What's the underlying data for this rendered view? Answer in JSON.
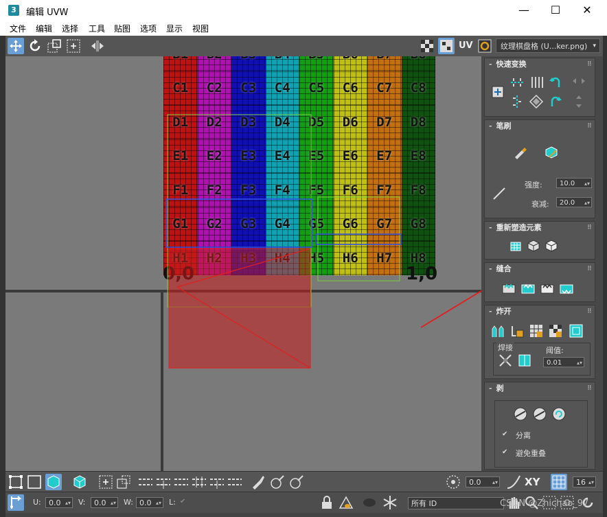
{
  "window": {
    "title": "编辑 UVW",
    "app_icon_text": "3",
    "minimize": "—",
    "maximize": "☐",
    "close": "✕"
  },
  "menu": [
    "文件",
    "编辑",
    "选择",
    "工具",
    "贴图",
    "选项",
    "显示",
    "视图"
  ],
  "toolbar": {
    "uv_label": "UV",
    "texture_dropdown": "纹理棋盘格 (U...ker.png)"
  },
  "texture": {
    "rows": [
      "B",
      "C",
      "D",
      "E",
      "F",
      "G",
      "H"
    ],
    "cols": [
      "1",
      "2",
      "3",
      "4",
      "5",
      "6",
      "7",
      "8"
    ],
    "column_colors": [
      "#c01010",
      "#b010b0",
      "#1010b0",
      "#10a0b0",
      "#10a010",
      "#c0c010",
      "#c07010",
      "#105010"
    ],
    "origin_label": "0,0",
    "corner_label": "1,0"
  },
  "panel": {
    "quick_transform": {
      "title": "快速变换"
    },
    "brush": {
      "title": "笔刷",
      "strength_label": "强度:",
      "strength_value": "10.0",
      "falloff_label": "衰减:",
      "falloff_value": "20.0"
    },
    "reshape": {
      "title": "重新塑造元素"
    },
    "stitch": {
      "title": "缝合"
    },
    "explode": {
      "title": "炸开",
      "weld_label": "焊接",
      "threshold_label": "阈值:",
      "threshold_value": "0.01"
    },
    "peel": {
      "title": "剥",
      "detach_label": "分离",
      "avoid_overlap_label": "避免重叠"
    }
  },
  "bottom": {
    "angle_value": "0.0",
    "xy_label": "XY",
    "grid_value": "16",
    "u_label": "U:",
    "u_value": "0.0",
    "v_label": "V:",
    "v_value": "0.0",
    "w_label": "W:",
    "w_value": "0.0",
    "l_label": "L:",
    "id_dropdown": "所有 ID"
  },
  "watermark": "CSDN @Zhichao_97",
  "colors": {
    "accent": "#6a9fd6",
    "annotation": "#e02020",
    "selection": "#3050e0"
  }
}
